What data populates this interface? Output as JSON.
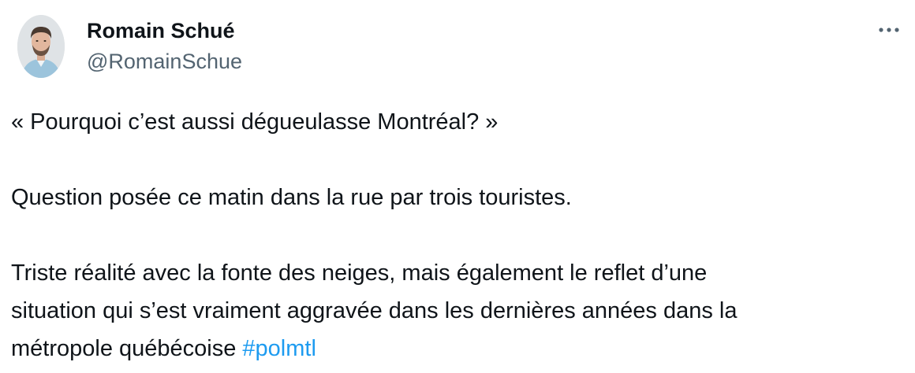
{
  "author": {
    "display_name": "Romain Schué",
    "handle": "@RomainSchue"
  },
  "menu": {
    "icon": "more-horizontal-icon"
  },
  "tweet": {
    "line1": "« Pourquoi c’est aussi dégueulasse Montréal? »",
    "line2": "Question posée ce matin dans la rue par trois touristes.",
    "line3": "Triste réalité avec la fonte des neiges, mais également le reflet d’une",
    "line4": "situation qui s’est vraiment aggravée dans les dernières années dans la",
    "line5_text": "métropole québécoise ",
    "hashtag": "#polmtl"
  },
  "colors": {
    "text": "#0f1419",
    "secondary": "#536471",
    "link": "#1d9bf0"
  }
}
